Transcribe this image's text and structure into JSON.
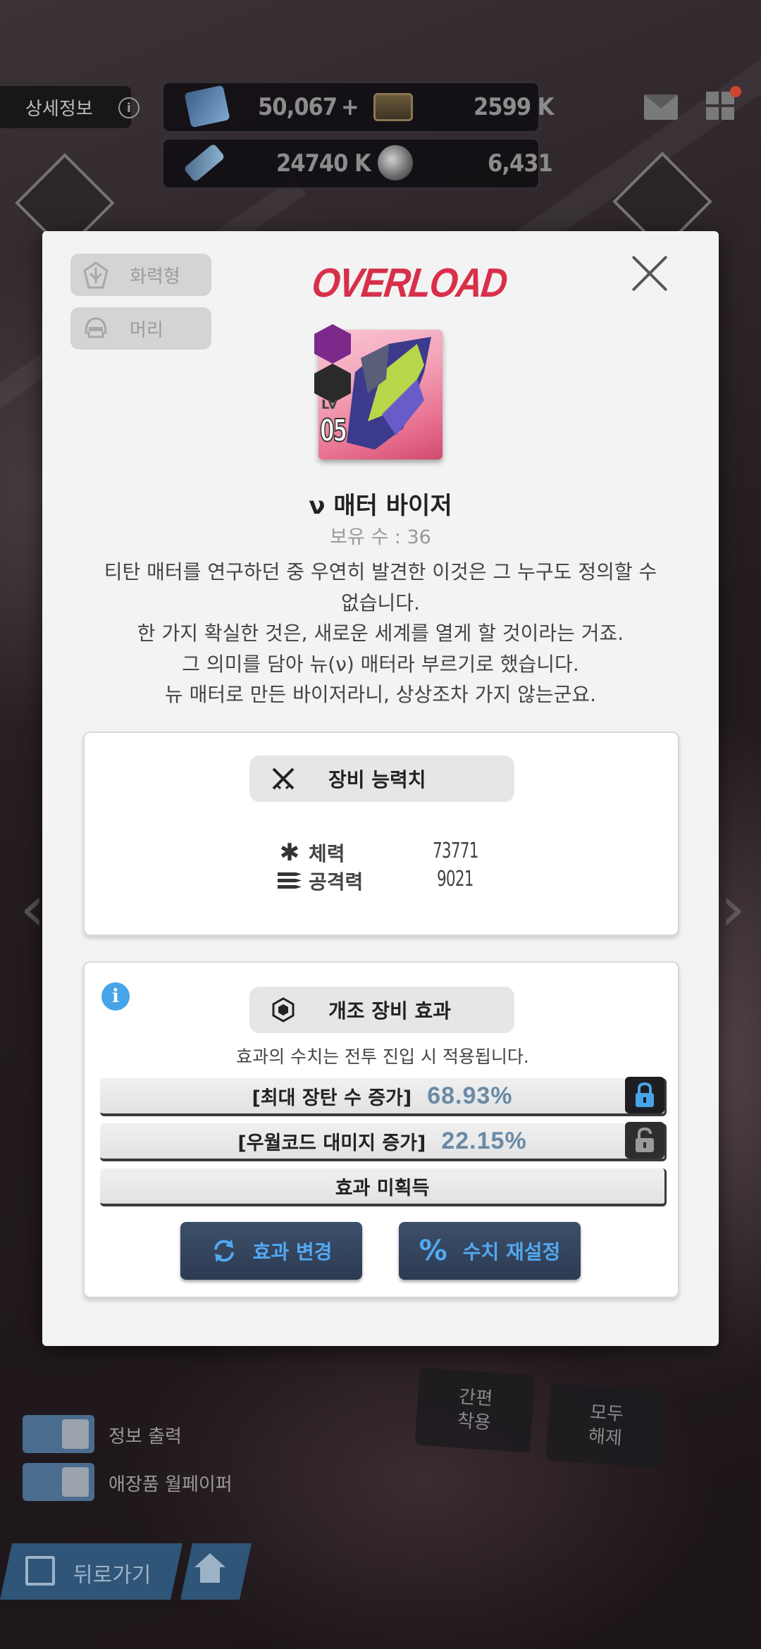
{
  "hud": {
    "detail_label": "상세정보",
    "info_icon": "i",
    "currency_gem": "50,067",
    "currency_gem_add": "+",
    "currency_credit": "2599 K",
    "currency_core": "24740 K",
    "currency_orb": "6,431",
    "notification_color": "#d0452e"
  },
  "modal": {
    "tag_type": "화력형",
    "tag_slot": "머리",
    "title": "OVERLOAD",
    "title_color": "#d8304a",
    "item": {
      "lv_label": "LV",
      "lv_value": "05",
      "name": "ν 매터 바이저",
      "count": "보유 수 : 36",
      "description_lines": [
        "티탄 매터를 연구하던 중 우연히 발견한 이것은 그 누구도 정의할 수",
        "없습니다.",
        "한 가지 확실한 것은, 새로운 세계를 열게 할 것이라는 거죠.",
        "그 의미를 담아 뉴(ν) 매터라 부르기로 했습니다.",
        "뉴 매터로 만든 바이저라니, 상상조차 가지 않는군요."
      ]
    },
    "stats_panel": {
      "header": "장비 능력치",
      "stats": [
        {
          "icon": "asterisk-icon",
          "label": "체력",
          "value": "73771"
        },
        {
          "icon": "ammo-icon",
          "label": "공격력",
          "value": "9021"
        }
      ]
    },
    "mod_panel": {
      "info_icon": "i",
      "header": "개조 장비 효과",
      "note": "효과의 수치는 전투 진입 시 적용됩니다.",
      "effects": [
        {
          "label": "[최대 장탄 수 증가]",
          "value": "68.93%",
          "locked": true
        },
        {
          "label": "[우월코드 대미지 증가]",
          "value": "22.15%",
          "locked": false
        },
        {
          "label": "효과 미획득",
          "value": "",
          "locked": false
        }
      ],
      "change_button": "효과 변경",
      "reset_button": "수치 재설정",
      "accent_color": "#52a8f0"
    }
  },
  "bottom": {
    "toggle_info": "정보 출력",
    "toggle_wallpaper": "애장품 월페이퍼",
    "quick_equip": [
      "간편",
      "착용"
    ],
    "unequip_all": [
      "모두",
      "해제"
    ],
    "back_label": "뒤로가기"
  }
}
